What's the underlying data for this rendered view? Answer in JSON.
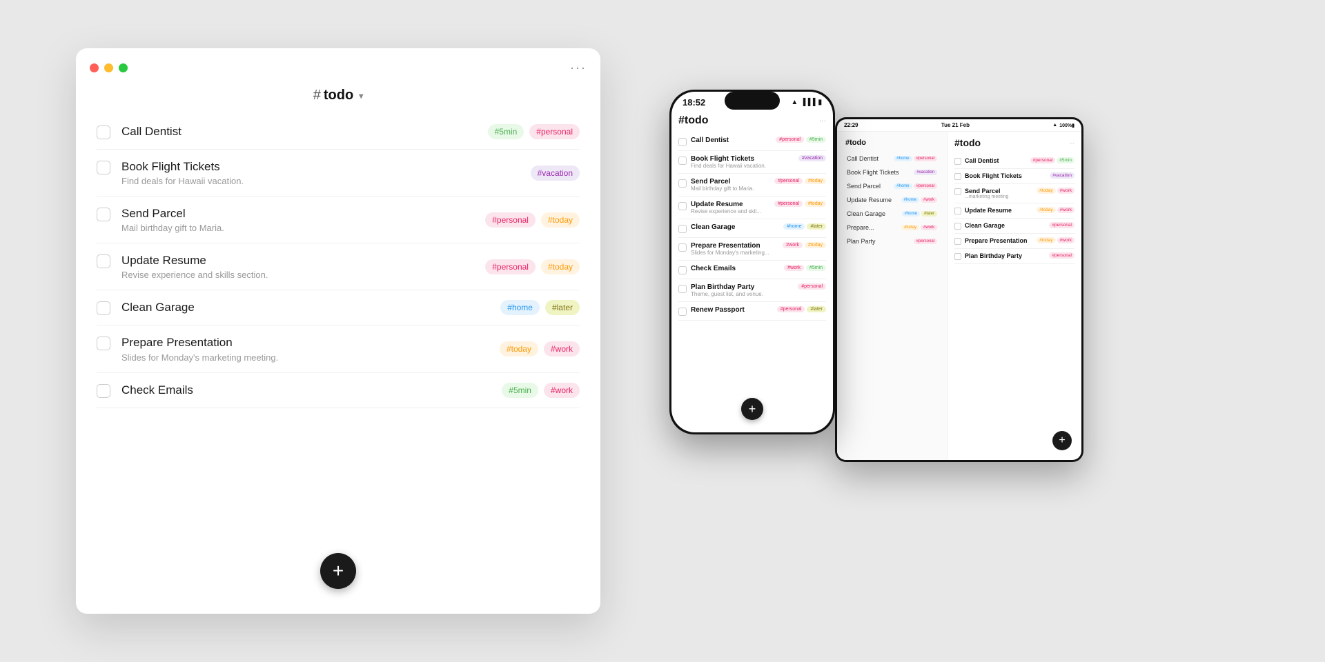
{
  "window": {
    "title": "todo",
    "title_prefix": "#",
    "menu_dots": "···",
    "add_button_label": "+"
  },
  "tasks": [
    {
      "id": 1,
      "name": "Call Dentist",
      "subtitle": "",
      "tags": [
        {
          "label": "#5min",
          "style": "5min"
        },
        {
          "label": "#personal",
          "style": "personal"
        }
      ]
    },
    {
      "id": 2,
      "name": "Book Flight Tickets",
      "subtitle": "Find deals for Hawaii vacation.",
      "tags": [
        {
          "label": "#vacation",
          "style": "vacation"
        }
      ]
    },
    {
      "id": 3,
      "name": "Send Parcel",
      "subtitle": "Mail birthday gift to Maria.",
      "tags": [
        {
          "label": "#personal",
          "style": "personal"
        },
        {
          "label": "#today",
          "style": "today"
        }
      ]
    },
    {
      "id": 4,
      "name": "Update Resume",
      "subtitle": "Revise experience and skills section.",
      "tags": [
        {
          "label": "#personal",
          "style": "personal"
        },
        {
          "label": "#today",
          "style": "today"
        }
      ]
    },
    {
      "id": 5,
      "name": "Clean Garage",
      "subtitle": "",
      "tags": [
        {
          "label": "#home",
          "style": "home"
        },
        {
          "label": "#later",
          "style": "later"
        }
      ]
    },
    {
      "id": 6,
      "name": "Prepare Presentation",
      "subtitle": "Slides for Monday's marketing meeting.",
      "tags": [
        {
          "label": "#today",
          "style": "today"
        },
        {
          "label": "#work",
          "style": "work"
        }
      ]
    },
    {
      "id": 7,
      "name": "Check Emails",
      "subtitle": "",
      "tags": [
        {
          "label": "#5min",
          "style": "5min"
        },
        {
          "label": "#work",
          "style": "work"
        }
      ]
    }
  ],
  "phone": {
    "time": "18:52",
    "title": "#todo",
    "tasks": [
      {
        "name": "Call Dentist",
        "subtitle": "",
        "tags": [
          "#personal",
          "#5min"
        ],
        "tag_styles": [
          "personal",
          "5min"
        ]
      },
      {
        "name": "Book Flight Tickets",
        "subtitle": "Find deals for Hawaii vacation.",
        "tags": [
          "#vacation"
        ],
        "tag_styles": [
          "vacation"
        ]
      },
      {
        "name": "Send Parcel",
        "subtitle": "Mail birthday gift to Maria.",
        "tags": [
          "#personal",
          "#today"
        ],
        "tag_styles": [
          "personal",
          "today"
        ]
      },
      {
        "name": "Update Resume",
        "subtitle": "Revise experience and skil...",
        "tags": [
          "#personal",
          "#today"
        ],
        "tag_styles": [
          "personal",
          "today"
        ]
      },
      {
        "name": "Clean Garage",
        "subtitle": "",
        "tags": [
          "#home",
          "#later"
        ],
        "tag_styles": [
          "home",
          "later"
        ]
      },
      {
        "name": "Prepare Presentation",
        "subtitle": "Slides for Monday's marketing...",
        "tags": [
          "#work",
          "#today"
        ],
        "tag_styles": [
          "work",
          "today"
        ]
      },
      {
        "name": "Check Emails",
        "subtitle": "",
        "tags": [
          "#work",
          "#5min"
        ],
        "tag_styles": [
          "work",
          "5min"
        ]
      },
      {
        "name": "Plan Birthday Party",
        "subtitle": "Theme, guest list, and venue.",
        "tags": [
          "#personal"
        ],
        "tag_styles": [
          "personal"
        ]
      },
      {
        "name": "Renew Passport",
        "subtitle": "",
        "tags": [
          "#personal",
          "#later"
        ],
        "tag_styles": [
          "personal",
          "later"
        ]
      }
    ]
  },
  "tablet": {
    "time": "22:29",
    "date": "Tue 21 Feb",
    "title": "#todo",
    "sidebar_items": [
      {
        "name": "Call Dentist",
        "tags": [
          "#home",
          "#personal"
        ],
        "tag_styles": [
          "home",
          "personal"
        ]
      },
      {
        "name": "Book Flight Tickets",
        "tags": [
          "#vacation"
        ],
        "tag_styles": [
          "vacation"
        ]
      },
      {
        "name": "Send Parcel",
        "tags": [
          "#home",
          "#personal"
        ],
        "tag_styles": [
          "home",
          "personal"
        ]
      },
      {
        "name": "Update Resume",
        "tags": [
          "#home",
          "#work"
        ],
        "tag_styles": [
          "home",
          "work"
        ]
      },
      {
        "name": "Clean Garage",
        "tags": [
          "#home",
          "#later"
        ],
        "tag_styles": [
          "home",
          "later"
        ]
      },
      {
        "name": "Prepare...",
        "tags": [
          "#today",
          "#work"
        ],
        "tag_styles": [
          "today",
          "work"
        ]
      },
      {
        "name": "Plan Party",
        "tags": [
          "#personal"
        ],
        "tag_styles": [
          "personal"
        ]
      }
    ],
    "tasks": [
      {
        "name": "Call Dentist",
        "subtitle": "",
        "tags": [
          "#personal",
          "#5min"
        ],
        "tag_styles": [
          "personal",
          "5min"
        ]
      },
      {
        "name": "Book Flight Tickets",
        "subtitle": "",
        "tags": [
          "#vacation"
        ],
        "tag_styles": [
          "vacation"
        ]
      },
      {
        "name": "Send Parcel",
        "subtitle": "...marketing meeting",
        "tags": [
          "#today",
          "#work"
        ],
        "tag_styles": [
          "today",
          "work"
        ]
      },
      {
        "name": "Update Resume",
        "subtitle": "",
        "tags": [
          "#today",
          "#work"
        ],
        "tag_styles": [
          "today",
          "work"
        ]
      },
      {
        "name": "Clean Garage",
        "subtitle": "",
        "tags": [
          "#personal"
        ],
        "tag_styles": [
          "personal"
        ]
      },
      {
        "name": "Prepare Presentation",
        "subtitle": "",
        "tags": [
          "#today",
          "#work"
        ],
        "tag_styles": [
          "today",
          "work"
        ]
      },
      {
        "name": "Plan Birthday Party",
        "subtitle": "",
        "tags": [
          "#personal"
        ],
        "tag_styles": [
          "personal"
        ]
      }
    ]
  },
  "colors": {
    "5min_bg": "#e8f9e8",
    "5min_fg": "#4caf50",
    "personal_bg": "#fce4ec",
    "personal_fg": "#e91e63",
    "vacation_bg": "#ede7f6",
    "vacation_fg": "#9c27b0",
    "today_bg": "#fff3e0",
    "today_fg": "#ff9800",
    "home_bg": "#e3f2fd",
    "home_fg": "#2196f3",
    "later_bg": "#f0f4c3",
    "later_fg": "#827717",
    "work_bg": "#fce4ec",
    "work_fg": "#e91e63"
  }
}
